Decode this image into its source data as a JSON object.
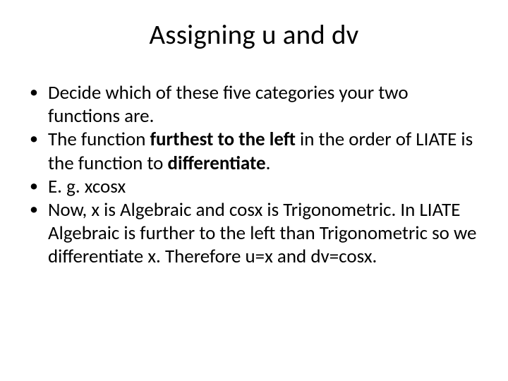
{
  "title": "Assigning u and dv",
  "bullets": [
    {
      "segments": [
        {
          "text": "Decide which of these five categories your two functions are.",
          "bold": false
        }
      ]
    },
    {
      "segments": [
        {
          "text": "The function ",
          "bold": false
        },
        {
          "text": "furthest to the left",
          "bold": true
        },
        {
          "text": " in the order of LIATE is the function to ",
          "bold": false
        },
        {
          "text": "differentiate",
          "bold": true
        },
        {
          "text": ".",
          "bold": false
        }
      ]
    },
    {
      "segments": [
        {
          "text": "E. g. xcosx",
          "bold": false
        }
      ]
    },
    {
      "segments": [
        {
          "text": "Now, x is Algebraic and cosx is Trigonometric. In LIATE Algebraic is further to the left than Trigonometric so we differentiate x. Therefore u=x and dv=cosx.",
          "bold": false
        }
      ]
    }
  ]
}
